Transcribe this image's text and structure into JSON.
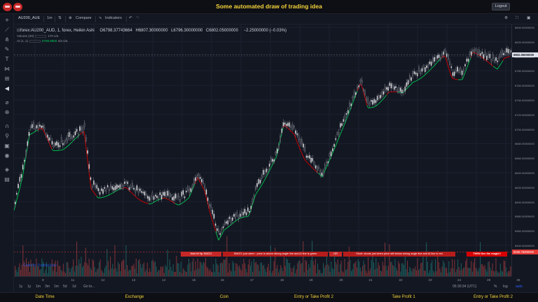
{
  "app": {
    "title": "Some automated draw of trading idea",
    "logout_label": "Logout"
  },
  "toolbar": {
    "symbol": "AU200_AUE",
    "interval": "1m",
    "compare_label": "Compare",
    "indicators_label": "Indicators"
  },
  "legend": {
    "series_title": "forex:AU200_AUD, 1, forex, Heikin Ashi",
    "open": "O6798.37743664",
    "high": "H6807.30000000",
    "low": "L6796.30000000",
    "close": "C6802.05000000",
    "change": "−2.25000000 (−0.03%)",
    "volume_label": "Volume (20)",
    "volume_values": "170   n/a",
    "ai_label": "AI (1, 1)",
    "ai_value": "6798.8800",
    "ai_extra": "n/a   n/a"
  },
  "annotations": [
    {
      "text": "Wait till flip SMGO",
      "color": "#e57373"
    },
    {
      "text": "SMGO: just when : price is above strong angle line and AI line is green",
      "color": "#e57373"
    },
    {
      "text": "OR",
      "color": "#e57373"
    },
    {
      "text": "Short: shorts just when price still below strong angle line and AI line is red",
      "color": "#e57373"
    },
    {
      "text": "THEN See the magic!!",
      "color": "#d32f2f"
    }
  ],
  "price_axis": {
    "ticks": [
      "6840.00000000",
      "6820.00000000",
      "6800.00000000",
      "6780.00000000",
      "6760.00000000",
      "6740.00000000",
      "6720.00000000",
      "6700.00000000",
      "6680.00000000",
      "6660.00000000",
      "6640.00000000",
      "6620.00000000",
      "6600.00000000",
      "6580.00000000",
      "6560.00000000",
      "6540.00000000"
    ],
    "current_price": "6802.05000000",
    "red_price": "6535.75000000"
  },
  "time_axis": {
    "ticks": [
      "8",
      "11",
      "12",
      "13",
      "14",
      "15",
      "16",
      "17",
      "18",
      "19",
      "20",
      "21",
      "22",
      "23",
      "24",
      "25",
      "26"
    ]
  },
  "range_bar": {
    "items": [
      "1y",
      "1y",
      "1m",
      "3m",
      "1m",
      "5d",
      "1d",
      "Go to..."
    ],
    "clock": "05:30:34 (UTC)",
    "percent": "%",
    "log": "log",
    "auto": "auto"
  },
  "watermark": "Chart by TradingView",
  "bottom_menu": [
    "Date Time",
    "Exchange",
    "Coin",
    "Entry or Take Profit 2",
    "Take Profit 1",
    "Entry or Take Profit 2"
  ],
  "colors": {
    "up": "#26a69a",
    "down": "#ef5350",
    "ai_green": "#00c853",
    "ai_red": "#d50000",
    "accent": "#f5d33b"
  }
}
